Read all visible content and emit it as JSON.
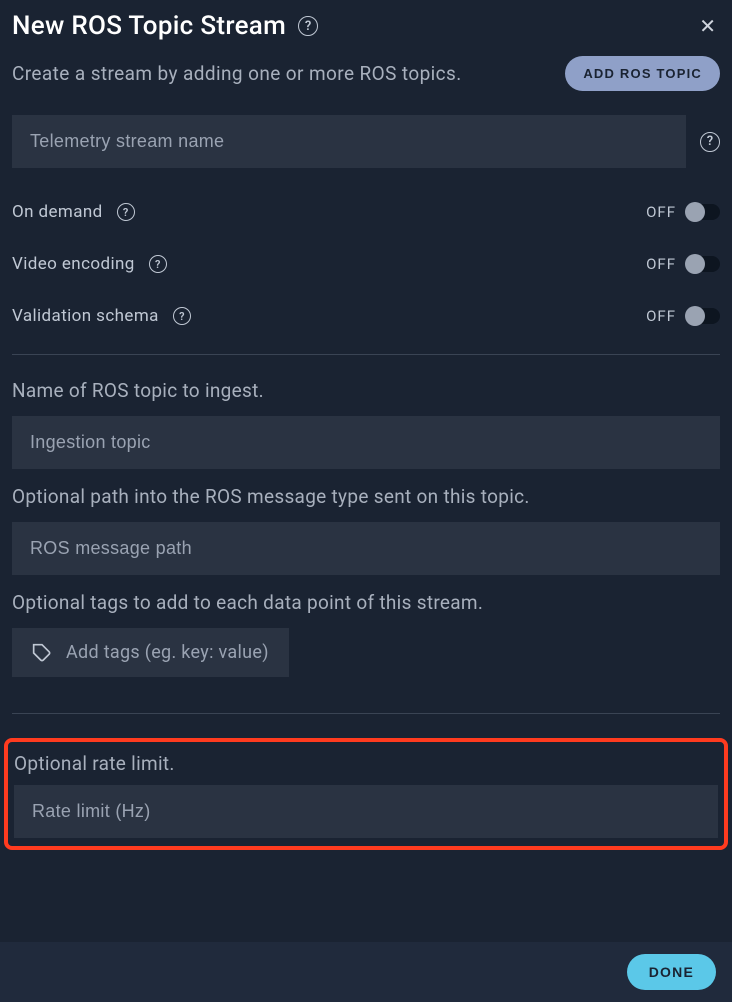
{
  "header": {
    "title": "New ROS Topic Stream",
    "subtitle": "Create a stream by adding one or more ROS topics.",
    "add_button": "ADD ROS TOPIC"
  },
  "stream_name": {
    "placeholder": "Telemetry stream name"
  },
  "toggles": {
    "on_demand": {
      "label": "On demand",
      "state": "OFF"
    },
    "video_encoding": {
      "label": "Video encoding",
      "state": "OFF"
    },
    "validation_schema": {
      "label": "Validation schema",
      "state": "OFF"
    }
  },
  "sections": {
    "ingest_label": "Name of ROS topic to ingest.",
    "ingest_placeholder": "Ingestion topic",
    "path_label": "Optional path into the ROS message type sent on this topic.",
    "path_placeholder": "ROS message path",
    "tags_label": "Optional tags to add to each data point of this stream.",
    "tags_placeholder": "Add tags (eg. key: value)",
    "rate_label": "Optional rate limit.",
    "rate_placeholder": "Rate limit (Hz)"
  },
  "footer": {
    "done": "DONE"
  }
}
